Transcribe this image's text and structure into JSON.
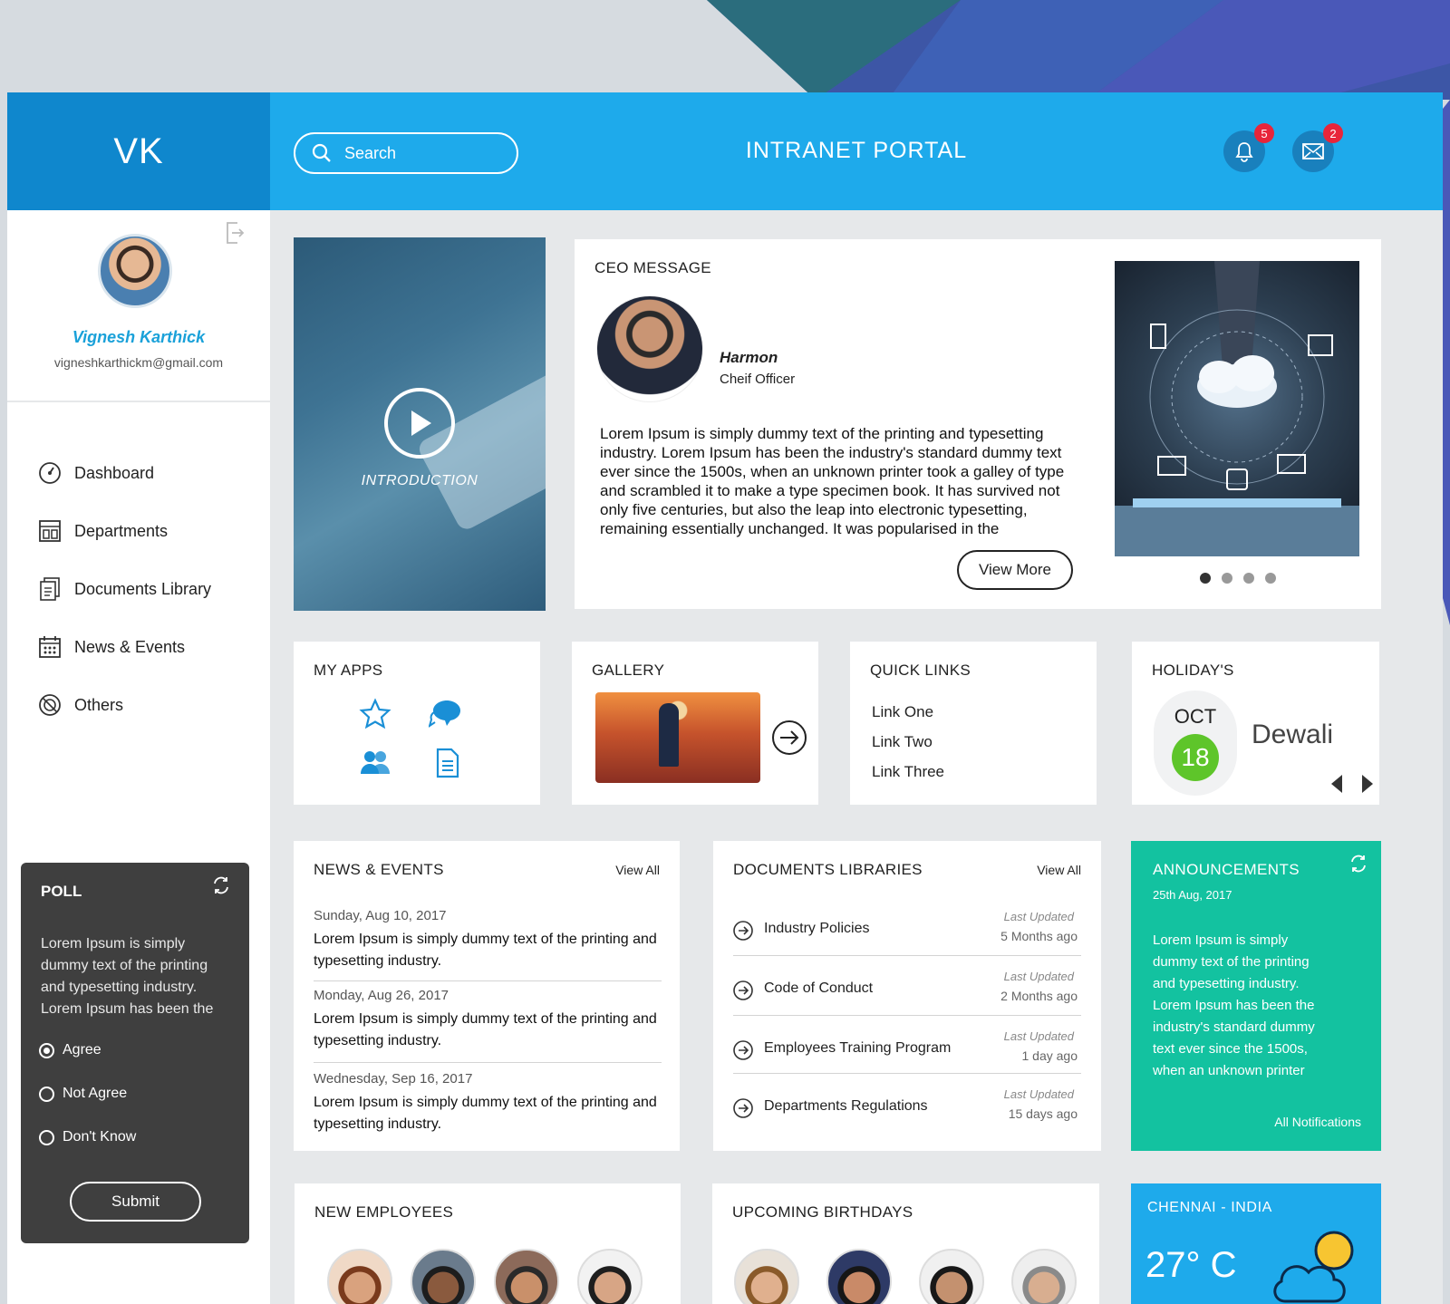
{
  "brand": {
    "initials": "VK"
  },
  "header": {
    "search_placeholder": "Search",
    "title": "INTRANET PORTAL",
    "notifications_count": "5",
    "messages_count": "2"
  },
  "user": {
    "name": "Vignesh Karthick",
    "email": "vigneshkarthickm@gmail.com"
  },
  "sidebar": {
    "items": [
      {
        "label": "Dashboard",
        "icon": "dashboard-icon"
      },
      {
        "label": "Departments",
        "icon": "departments-icon"
      },
      {
        "label": "Documents Library",
        "icon": "documents-icon"
      },
      {
        "label": "News & Events",
        "icon": "calendar-icon"
      },
      {
        "label": "Others",
        "icon": "others-icon"
      }
    ]
  },
  "poll": {
    "title": "POLL",
    "question": "Lorem Ipsum is simply dummy text of the printing and typesetting industry. Lorem Ipsum has been the",
    "options": [
      "Agree",
      "Not Agree",
      "Don't Know"
    ],
    "selected": "Agree",
    "submit_label": "Submit"
  },
  "intro": {
    "label": "INTRODUCTION"
  },
  "ceo": {
    "title": "CEO MESSAGE",
    "name": "Harmon",
    "role": "Cheif Officer",
    "message": "Lorem Ipsum is simply dummy text of the printing and typesetting industry. Lorem Ipsum has been the industry's standard dummy text ever since the 1500s, when an unknown printer took a galley of type and scrambled it to make a type specimen book. It has survived not only five centuries, but also the leap into electronic typesetting, remaining essentially unchanged. It was popularised in the",
    "button": "View More",
    "slides": 4,
    "active_slide": 1
  },
  "my_apps": {
    "title": "MY APPS",
    "icons": [
      "star-icon",
      "chat-icon",
      "users-icon",
      "document-icon"
    ]
  },
  "gallery": {
    "title": "GALLERY"
  },
  "quick_links": {
    "title": "QUICK LINKS",
    "links": [
      "Link One",
      "Link Two",
      "Link Three"
    ]
  },
  "holidays": {
    "title": "HOLIDAY'S",
    "month": "OCT",
    "day": "18",
    "name": "Dewali"
  },
  "news": {
    "title": "NEWS & EVENTS",
    "view_all": "View All",
    "items": [
      {
        "date": "Sunday, Aug 10, 2017",
        "text": "Lorem Ipsum is simply dummy text of the printing and typesetting industry."
      },
      {
        "date": "Monday, Aug 26, 2017",
        "text": "Lorem Ipsum is simply dummy text of the printing and typesetting industry."
      },
      {
        "date": "Wednesday, Sep 16, 2017",
        "text": "Lorem Ipsum is simply dummy text of the printing and typesetting industry."
      }
    ]
  },
  "docs": {
    "title": "DOCUMENTS LIBRARIES",
    "view_all": "View All",
    "items": [
      {
        "name": "Industry Policies",
        "updated_label": "Last Updated",
        "ago": "5 Months ago"
      },
      {
        "name": "Code of Conduct",
        "updated_label": "Last Updated",
        "ago": "2 Months ago"
      },
      {
        "name": "Employees Training Program",
        "updated_label": "Last Updated",
        "ago": "1 day ago"
      },
      {
        "name": "Departments Regulations",
        "updated_label": "Last Updated",
        "ago": "15 days ago"
      }
    ]
  },
  "announcements": {
    "title": "ANNOUNCEMENTS",
    "date": "25th Aug, 2017",
    "text": "Lorem Ipsum is simply dummy text of the printing and typesetting industry. Lorem Ipsum has been the industry's standard dummy text ever since the 1500s, when an unknown printer",
    "link": "All Notifications"
  },
  "new_employees": {
    "title": "NEW EMPLOYEES"
  },
  "birthdays": {
    "title": "UPCOMING BIRTHDAYS"
  },
  "weather": {
    "city": "CHENNAI - INDIA",
    "temp": "27° C"
  },
  "colors": {
    "brand_dark": "#0f87cd",
    "brand": "#1eaaeb",
    "accent_green": "#13c2a0",
    "holiday_green": "#5ec52a",
    "badge_red": "#e8253a"
  }
}
